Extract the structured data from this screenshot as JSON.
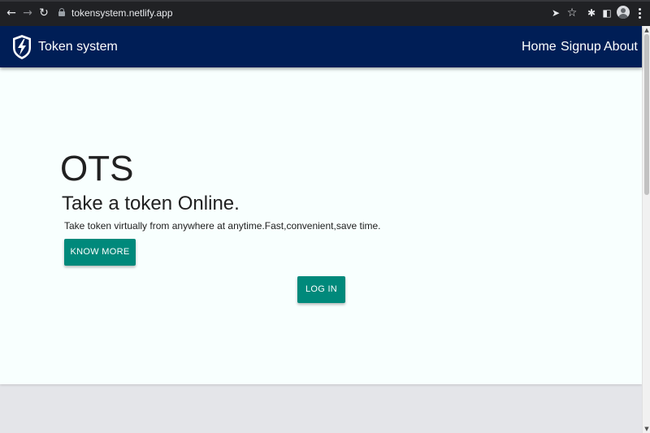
{
  "browser": {
    "url": "tokensystem.netlify.app",
    "back_icon": "←",
    "forward_icon": "→",
    "reload_icon": "↻",
    "send_icon": "➤",
    "star_icon": "☆",
    "extensions_icon": "✱",
    "sidepanel_icon": "◧"
  },
  "navbar": {
    "brand": "Token system",
    "links": [
      "Home",
      "Signup",
      "About"
    ],
    "background": "#001e56"
  },
  "hero": {
    "title": "OTS",
    "subtitle": "Take a token Online.",
    "description": "Take token virtually from anywhere at anytime.Fast,convenient,save time.",
    "know_more_label": "KNOW MORE",
    "login_label": "LOG IN",
    "accent": "#00897b",
    "background": "#f8fffe"
  },
  "scrollbar": {
    "up_arrow": "▲",
    "down_arrow": "▼"
  }
}
